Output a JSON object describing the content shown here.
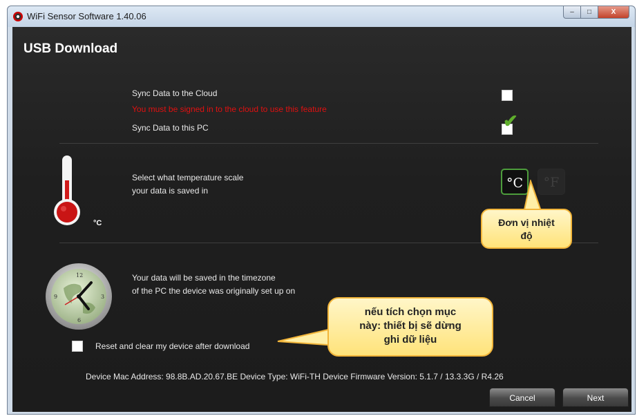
{
  "window": {
    "title": "WiFi Sensor Software 1.40.06",
    "buttons": [
      "–",
      "□",
      "X"
    ]
  },
  "page": {
    "title": "USB Download"
  },
  "sync": {
    "cloud_label": "Sync Data to the Cloud",
    "cloud_warning": "You must be signed in to the cloud to use this feature",
    "cloud_checked": false,
    "pc_label": "Sync Data to this PC",
    "pc_checked": true
  },
  "temperature": {
    "icon_unit": "°C",
    "prompt_line1": "Select what temperature scale",
    "prompt_line2": "your data is saved in",
    "options": [
      "°C",
      "°F"
    ],
    "selected": "°C"
  },
  "timezone": {
    "line1": "Your data will be saved in the timezone",
    "line2": "of the PC the device was originally set up on"
  },
  "reset": {
    "label": "Reset and clear my device after download",
    "checked": false
  },
  "device_info": "Device Mac Address: 98.8B.AD.20.67.BE  Device Type: WiFi-TH  Device Firmware Version: 5.1.7 / 13.3.3G / R4.26",
  "buttons": {
    "cancel": "Cancel",
    "next": "Next"
  },
  "callouts": {
    "temperature": [
      "Đơn vị nhiệt",
      "độ"
    ],
    "reset": [
      "nếu tích chọn mục",
      "này: thiết bị sẽ dừng",
      "ghi dữ liệu"
    ]
  },
  "colors": {
    "warning": "#e01010",
    "accent_green": "#4d9d3c",
    "callout_fill": "#ffe37a"
  }
}
